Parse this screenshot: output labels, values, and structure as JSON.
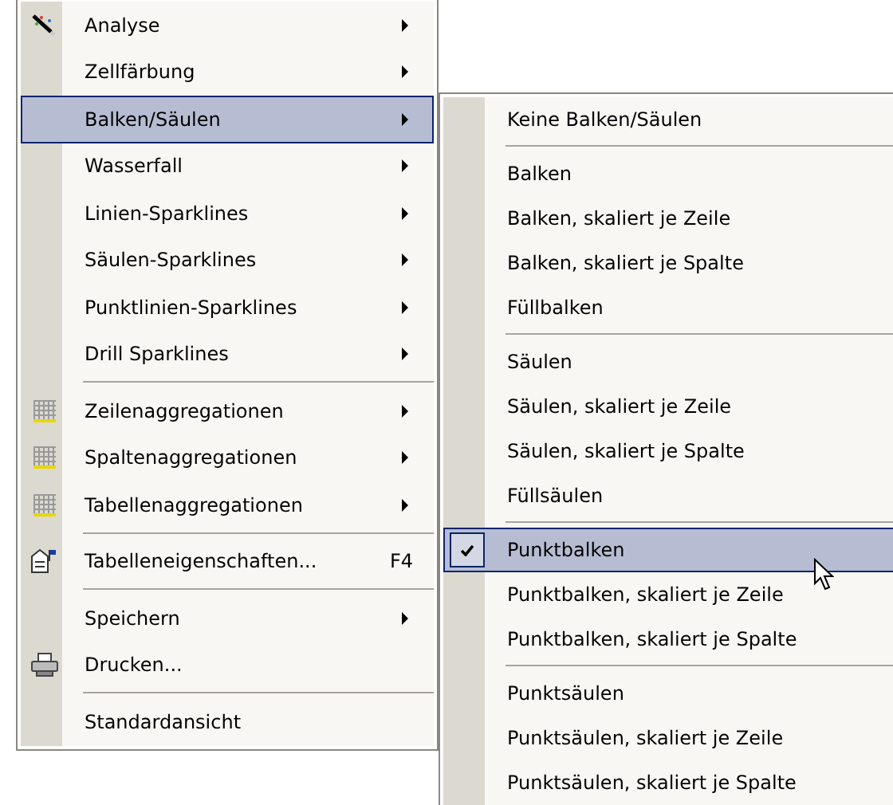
{
  "main_menu": {
    "items": [
      {
        "kind": "item",
        "label": "Analyse",
        "submenu": true,
        "selected": false
      },
      {
        "kind": "item",
        "label": "Zellfärbung",
        "submenu": true,
        "selected": false
      },
      {
        "kind": "item",
        "label": "Balken/Säulen",
        "submenu": true,
        "selected": true
      },
      {
        "kind": "item",
        "label": "Wasserfall",
        "submenu": true,
        "selected": false
      },
      {
        "kind": "item",
        "label": "Linien-Sparklines",
        "submenu": true,
        "selected": false
      },
      {
        "kind": "item",
        "label": "Säulen-Sparklines",
        "submenu": true,
        "selected": false
      },
      {
        "kind": "item",
        "label": "Punktlinien-Sparklines",
        "submenu": true,
        "selected": false
      },
      {
        "kind": "item",
        "label": "Drill Sparklines",
        "submenu": true,
        "selected": false
      },
      {
        "kind": "separator"
      },
      {
        "kind": "item",
        "label": "Zeilenaggregationen",
        "submenu": true,
        "selected": false
      },
      {
        "kind": "item",
        "label": "Spaltenaggregationen",
        "submenu": true,
        "selected": false
      },
      {
        "kind": "item",
        "label": "Tabellenaggregationen",
        "submenu": true,
        "selected": false
      },
      {
        "kind": "separator"
      },
      {
        "kind": "item",
        "label": "Tabelleneigenschaften...",
        "shortcut": "F4",
        "submenu": false,
        "selected": false
      },
      {
        "kind": "separator"
      },
      {
        "kind": "item",
        "label": "Speichern",
        "submenu": true,
        "selected": false
      },
      {
        "kind": "item",
        "label": "Drucken...",
        "submenu": false,
        "selected": false
      },
      {
        "kind": "separator"
      },
      {
        "kind": "item",
        "label": "Standardansicht",
        "submenu": false,
        "selected": false
      }
    ]
  },
  "submenu": {
    "items": [
      {
        "kind": "item",
        "label": "Keine Balken/Säulen",
        "checked": false,
        "selected": false
      },
      {
        "kind": "separator"
      },
      {
        "kind": "item",
        "label": "Balken",
        "checked": false,
        "selected": false
      },
      {
        "kind": "item",
        "label": "Balken, skaliert je Zeile",
        "checked": false,
        "selected": false
      },
      {
        "kind": "item",
        "label": "Balken, skaliert je Spalte",
        "checked": false,
        "selected": false
      },
      {
        "kind": "item",
        "label": "Füllbalken",
        "checked": false,
        "selected": false
      },
      {
        "kind": "separator"
      },
      {
        "kind": "item",
        "label": "Säulen",
        "checked": false,
        "selected": false
      },
      {
        "kind": "item",
        "label": "Säulen, skaliert je Zeile",
        "checked": false,
        "selected": false
      },
      {
        "kind": "item",
        "label": "Säulen, skaliert je Spalte",
        "checked": false,
        "selected": false
      },
      {
        "kind": "item",
        "label": "Füllsäulen",
        "checked": false,
        "selected": false
      },
      {
        "kind": "separator"
      },
      {
        "kind": "item",
        "label": "Punktbalken",
        "checked": true,
        "selected": true
      },
      {
        "kind": "item",
        "label": "Punktbalken, skaliert je Zeile",
        "checked": false,
        "selected": false
      },
      {
        "kind": "item",
        "label": "Punktbalken, skaliert je Spalte",
        "checked": false,
        "selected": false
      },
      {
        "kind": "separator"
      },
      {
        "kind": "item",
        "label": "Punktsäulen",
        "checked": false,
        "selected": false
      },
      {
        "kind": "item",
        "label": "Punktsäulen, skaliert je Zeile",
        "checked": false,
        "selected": false
      },
      {
        "kind": "item",
        "label": "Punktsäulen, skaliert je Spalte",
        "checked": false,
        "selected": false
      }
    ]
  }
}
